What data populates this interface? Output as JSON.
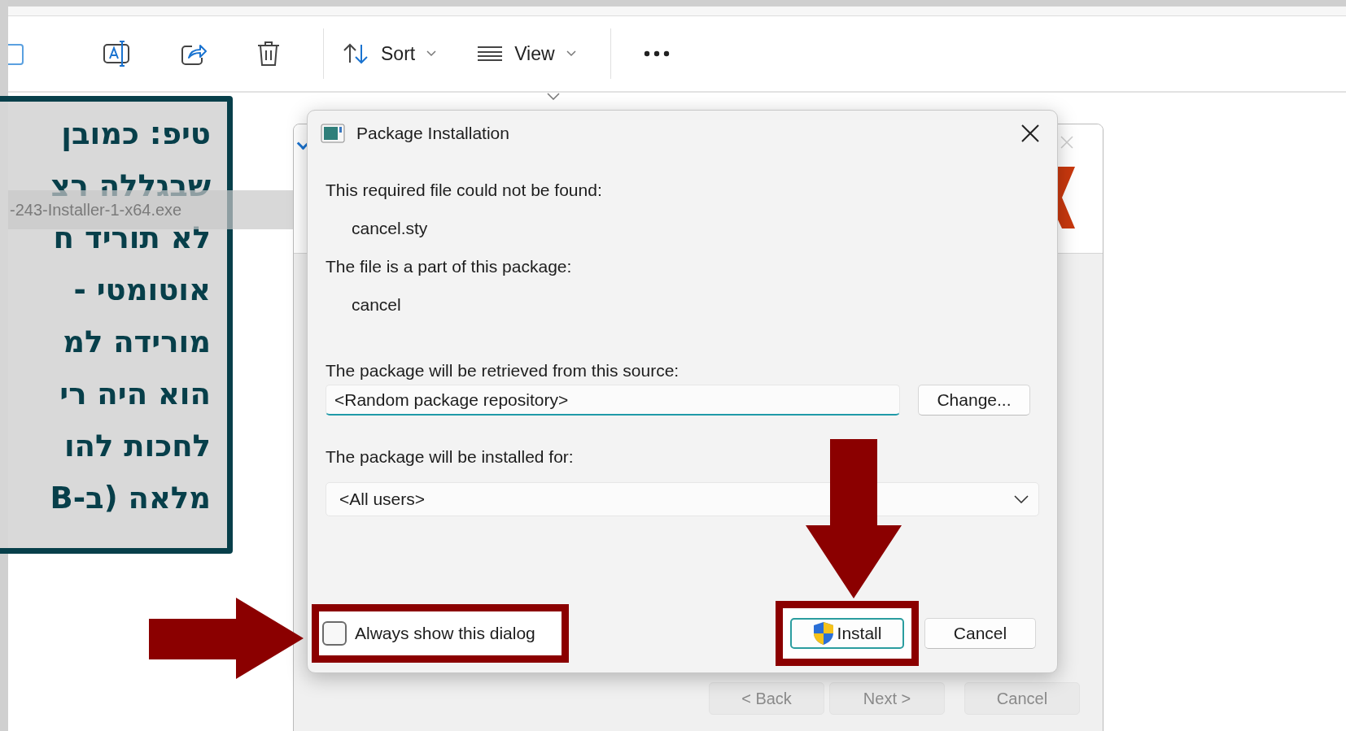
{
  "toolbar": {
    "sort": {
      "label": "Sort"
    },
    "view": {
      "label": "View"
    }
  },
  "file_list": {
    "rows": [
      {
        "name": "-243-Installer-1-x64.exe",
        "selected": true
      }
    ]
  },
  "tip_overlay": {
    "lines": [
      "טיפ: כמובן",
      "שבגללה רצ",
      "לא תוריד ח",
      "אוטומטי -",
      "מורידה למ",
      "הוא היה רי",
      "לחכות להו",
      "מלאה (ב-B"
    ]
  },
  "wizard_window": {
    "buttons": [
      {
        "label": "< Back",
        "disabled": true
      },
      {
        "label": "Next >",
        "disabled": true
      },
      {
        "label": "Cancel",
        "disabled": true
      }
    ]
  },
  "dialog": {
    "title": "Package Installation",
    "sections": [
      {
        "label": "This required file could not be found:",
        "value": "cancel.sty"
      },
      {
        "label": "The file is a part of this package:",
        "value": "cancel"
      }
    ],
    "source": {
      "label": "The package will be retrieved from this source:",
      "value": "<Random package repository>",
      "button": "Change..."
    },
    "installed_for": {
      "label": "The package will be installed for:",
      "value": "<All users>"
    },
    "always_show": {
      "label": "Always show this dialog",
      "checked": false
    },
    "buttons": [
      {
        "label": "Install",
        "kind": "primary"
      },
      {
        "label": "Cancel",
        "kind": "secondary"
      }
    ]
  }
}
